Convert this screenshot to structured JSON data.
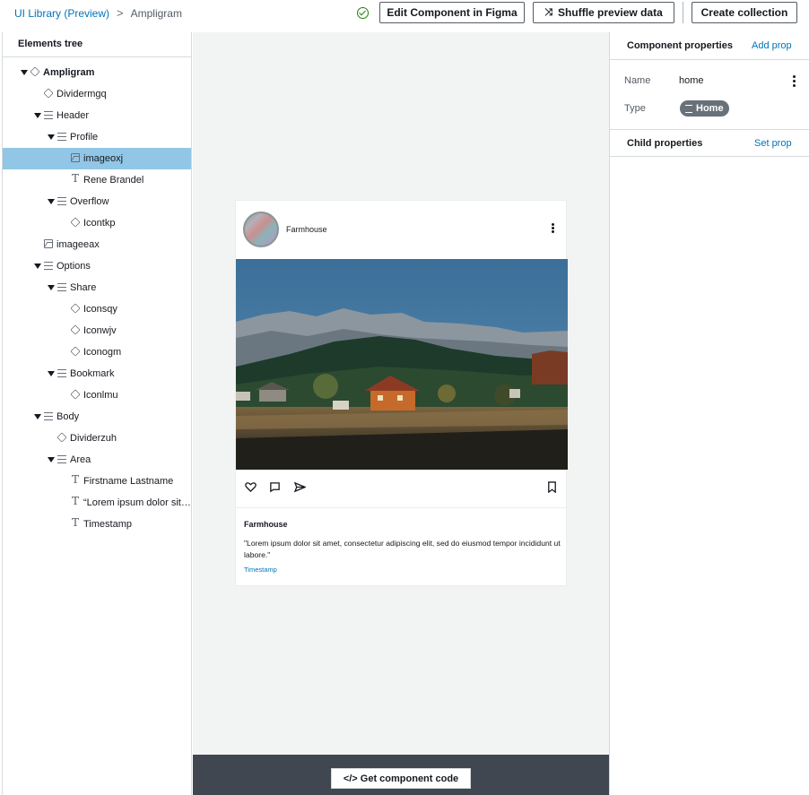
{
  "breadcrumb": {
    "root": "UI Library (Preview)",
    "separator": ">",
    "current": "Ampligram"
  },
  "toolbar": {
    "edit_label": "Edit Component in Figma",
    "shuffle_label": "Shuffle preview data",
    "create_label": "Create collection",
    "status_icon": "check-circle-icon",
    "status_color": "#1d8102"
  },
  "tree": {
    "title": "Elements tree",
    "items": [
      {
        "label": "Ampligram",
        "icon": "cube-icon"
      },
      {
        "label": "Dividermgq",
        "icon": "cube-icon"
      },
      {
        "label": "Header",
        "icon": "list-icon"
      },
      {
        "label": "Profile",
        "icon": "list-icon"
      },
      {
        "label": "imageoxj",
        "icon": "image-icon"
      },
      {
        "label": "Rene Brandel",
        "icon": "text-icon"
      },
      {
        "label": "Overflow",
        "icon": "list-icon"
      },
      {
        "label": "Icontkp",
        "icon": "cube-icon"
      },
      {
        "label": "imageeax",
        "icon": "image-icon"
      },
      {
        "label": "Options",
        "icon": "list-icon"
      },
      {
        "label": "Share",
        "icon": "list-icon"
      },
      {
        "label": "Iconsqy",
        "icon": "cube-icon"
      },
      {
        "label": "Iconwjv",
        "icon": "cube-icon"
      },
      {
        "label": "Iconogm",
        "icon": "cube-icon"
      },
      {
        "label": "Bookmark",
        "icon": "list-icon"
      },
      {
        "label": "Iconlmu",
        "icon": "cube-icon"
      },
      {
        "label": "Body",
        "icon": "list-icon"
      },
      {
        "label": "Dividerzuh",
        "icon": "cube-icon"
      },
      {
        "label": "Area",
        "icon": "list-icon"
      },
      {
        "label": "Firstname Lastname",
        "icon": "text-icon"
      },
      {
        "label": "“Lorem ipsum dolor sit…",
        "icon": "text-icon"
      },
      {
        "label": "Timestamp",
        "icon": "text-icon"
      }
    ],
    "selected": "imageoxj",
    "selected_color": "#92c6e6"
  },
  "preview": {
    "username": "Farmhouse",
    "title": "Farmhouse",
    "description": "\"Lorem ipsum dolor sit amet, consectetur adipiscing elit, sed do eiusmod tempor incididunt ut labore.\"",
    "timestamp": "Timestamp",
    "actions": [
      "heart-icon",
      "comment-icon",
      "send-icon",
      "bookmark-icon"
    ]
  },
  "footer": {
    "code_button": "</> Get component code",
    "bg_color": "#414750"
  },
  "properties": {
    "component_title": "Component properties",
    "add_prop": "Add prop",
    "name_label": "Name",
    "name_value": "home",
    "type_label": "Type",
    "type_value": "Home",
    "child_title": "Child properties",
    "set_prop": "Set prop"
  }
}
